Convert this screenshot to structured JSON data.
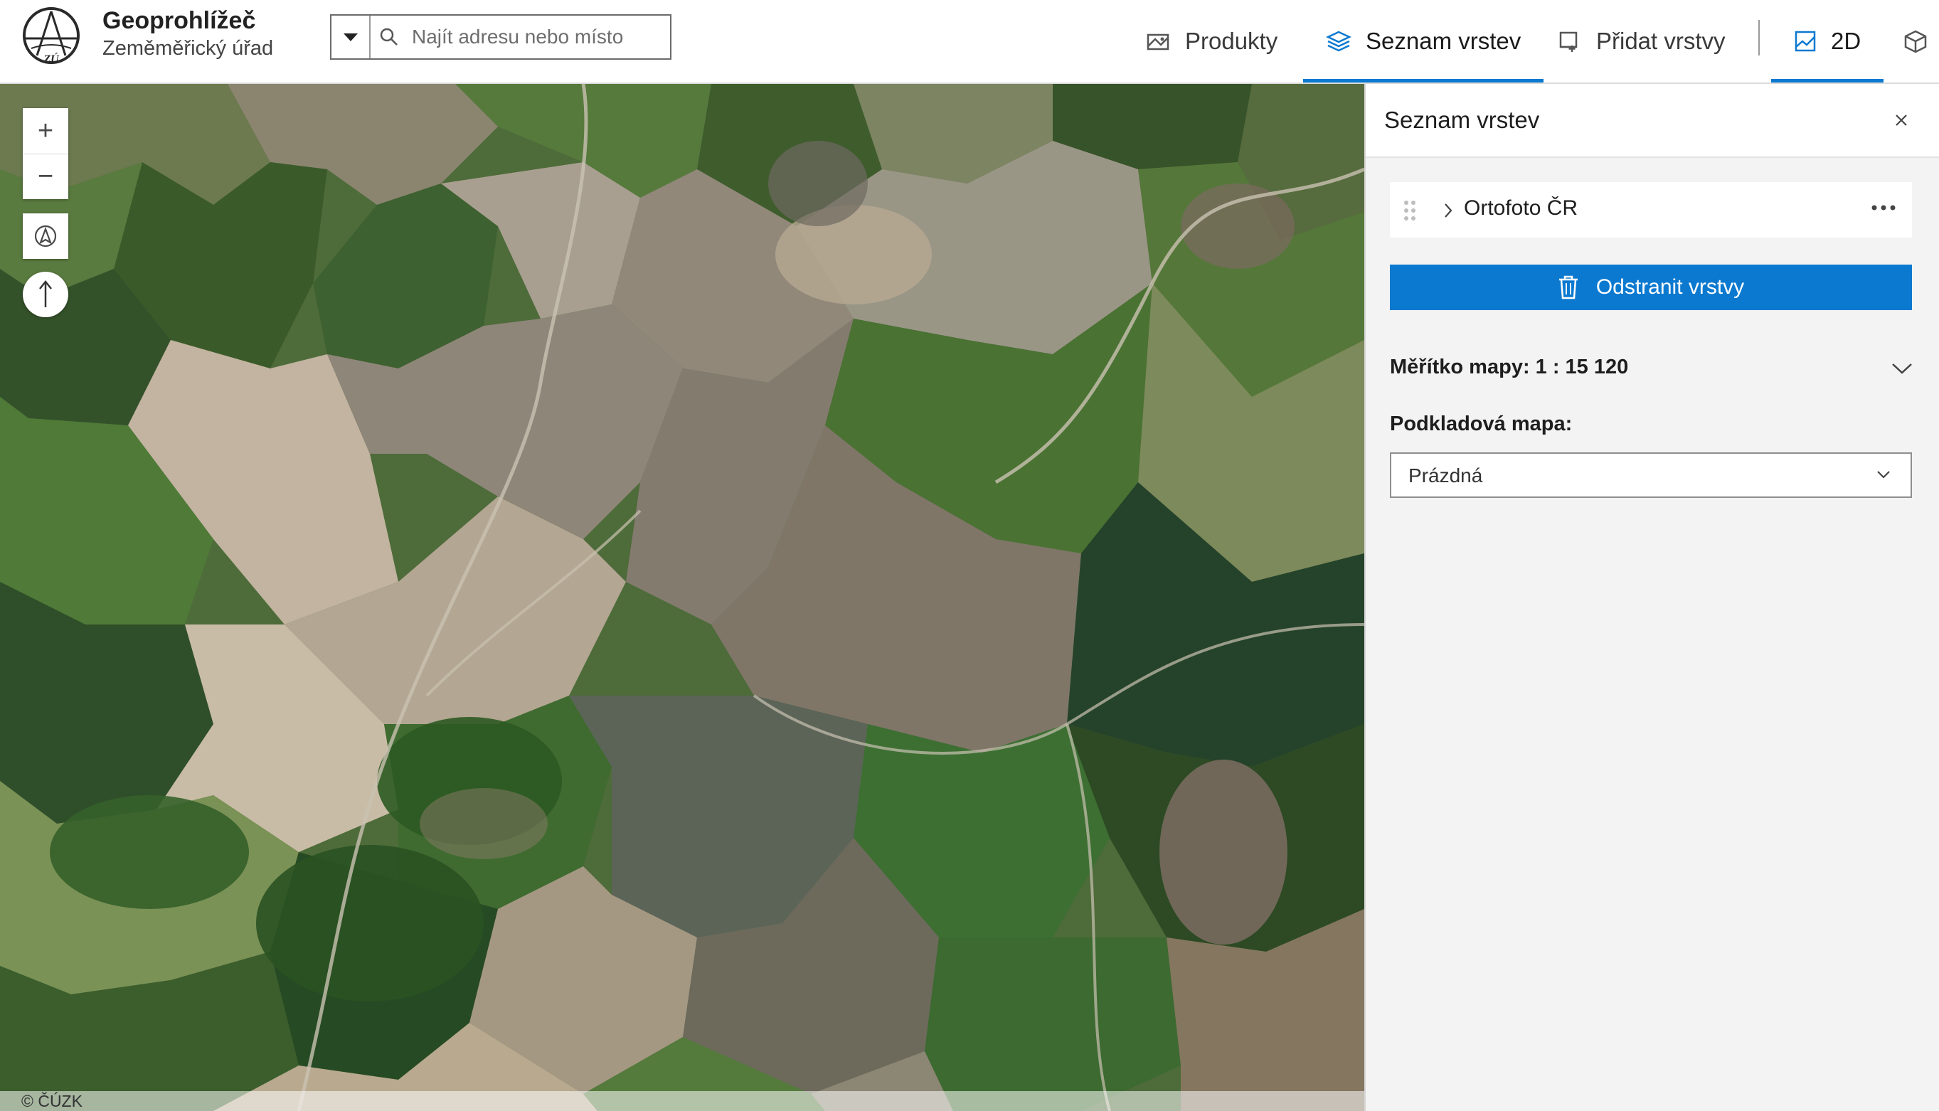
{
  "header": {
    "app_title": "Geoprohlížeč",
    "app_subtitle": "Zeměměřický úřad",
    "logo_icon": "zu-logo-icon",
    "search": {
      "placeholder": "Najít adresu nebo místo",
      "value": ""
    },
    "nav": [
      {
        "label": "Produkty",
        "icon": "map-icon",
        "active": false
      },
      {
        "label": "Seznam vrstev",
        "icon": "layers-icon",
        "active": true
      },
      {
        "label": "Přidat vrstvy",
        "icon": "add-layer-icon",
        "active": false
      },
      {
        "label": "2D",
        "icon": "map-2d-icon",
        "active": true
      },
      {
        "label": "",
        "icon": "cube-3d-icon",
        "active": false
      }
    ],
    "accent_color": "#0b79d0"
  },
  "map": {
    "controls": {
      "zoom_in": "+",
      "zoom_out": "−"
    },
    "attribution": "© ČÚZK"
  },
  "panel": {
    "title": "Seznam vrstev",
    "layers": [
      {
        "label": "Ortofoto ČR"
      }
    ],
    "remove_button": "Odstranit vrstvy",
    "scale_label": "Měřítko mapy: 1 : 15 120",
    "basemap_label": "Podkladová mapa:",
    "basemap_value": "Prázdná"
  }
}
